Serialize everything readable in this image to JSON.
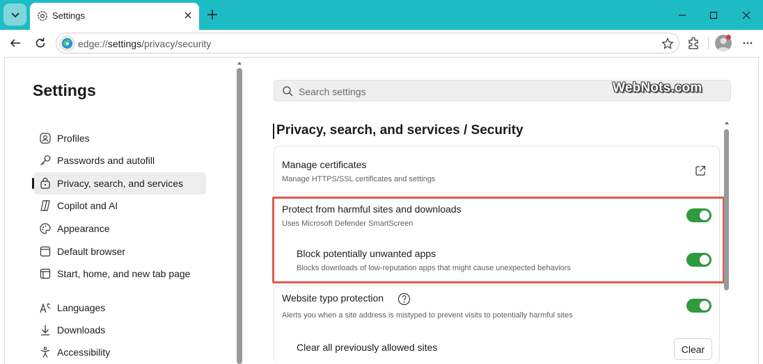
{
  "browser": {
    "tab_title": "Settings",
    "url_prefix": "edge://",
    "url_bold": "settings",
    "url_rest": "/privacy/security"
  },
  "colors": {
    "titlebar": "#1ebcc4",
    "toggle_on": "#2f9a3e",
    "highlight": "#e05a4c"
  },
  "sidebar": {
    "heading": "Settings",
    "items": [
      {
        "label": "Profiles",
        "icon": "profile-icon",
        "active": false
      },
      {
        "label": "Passwords and autofill",
        "icon": "key-icon",
        "active": false
      },
      {
        "label": "Privacy, search, and services",
        "icon": "lock-icon",
        "active": true
      },
      {
        "label": "Copilot and AI",
        "icon": "copilot-icon",
        "active": false
      },
      {
        "label": "Appearance",
        "icon": "palette-icon",
        "active": false
      },
      {
        "label": "Default browser",
        "icon": "browser-window-icon",
        "active": false
      },
      {
        "label": "Start, home, and new tab page",
        "icon": "home-page-icon",
        "active": false
      },
      {
        "label": "Languages",
        "icon": "languages-icon",
        "active": false
      },
      {
        "label": "Downloads",
        "icon": "download-icon",
        "active": false
      },
      {
        "label": "Accessibility",
        "icon": "accessibility-icon",
        "active": false
      }
    ]
  },
  "main": {
    "search_placeholder": "Search settings",
    "watermark": "WebNots.com",
    "page_title": "Privacy, search, and services / Security",
    "rows": {
      "certs": {
        "label": "Manage certificates",
        "sub": "Manage HTTPS/SSL certificates and settings"
      },
      "protect": {
        "label": "Protect from harmful sites and downloads",
        "sub": "Uses Microsoft Defender SmartScreen",
        "on": true
      },
      "pua": {
        "label": "Block potentially unwanted apps",
        "sub": "Blocks downloads of low-reputation apps that might cause unexpected behaviors",
        "on": true
      },
      "typo": {
        "label": "Website typo protection",
        "sub": "Alerts you when a site address is mistyped to prevent visits to potentially harmful sites",
        "on": true
      },
      "clear": {
        "label": "Clear all previously allowed sites",
        "button": "Clear"
      }
    }
  }
}
